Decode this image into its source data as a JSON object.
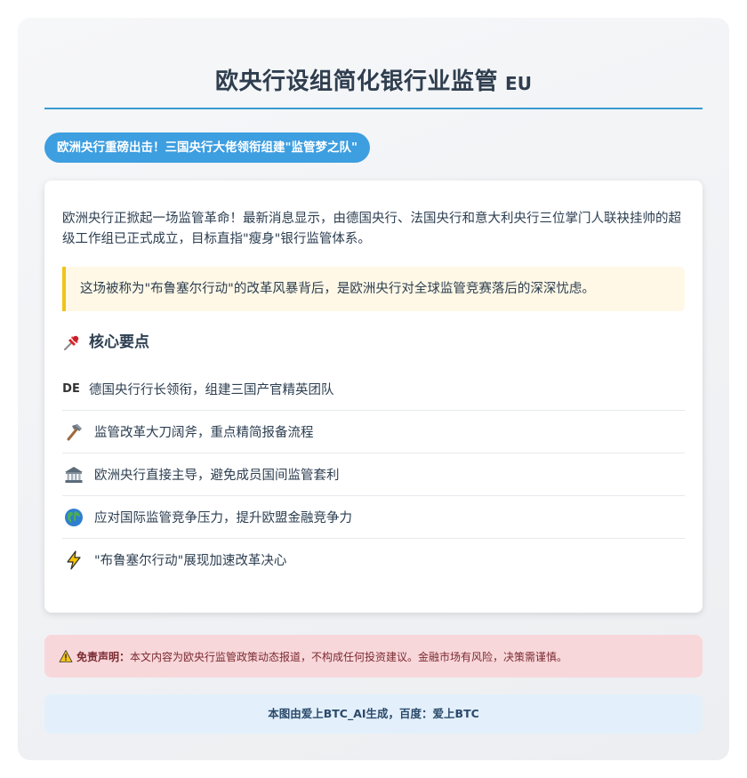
{
  "header": {
    "title": "欧央行设组简化银行业监管",
    "flag": "EU"
  },
  "badge": "欧洲央行重磅出击！三国央行大佬领衔组建\"监管梦之队\"",
  "article": {
    "intro": "欧洲央行正掀起一场监管革命！最新消息显示，由德国央行、法国央行和意大利央行三位掌门人联袂挂帅的超级工作组已正式成立，目标直指\"瘦身\"银行监管体系。",
    "quote": "这场被称为\"布鲁塞尔行动\"的改革风暴背后，是欧洲央行对全球监管竞赛落后的深深忧虑。",
    "section_title": "核心要点",
    "section_icon": "pushpin-icon",
    "points": [
      {
        "icon": "DE",
        "text": "德国央行行长领衔，组建三国产官精英团队"
      },
      {
        "icon": "hammer-icon",
        "text": "监管改革大刀阔斧，重点精简报备流程"
      },
      {
        "icon": "bank-icon",
        "text": "欧洲央行直接主导，避免成员国间监管套利"
      },
      {
        "icon": "globe-icon",
        "text": "应对国际监管竞争压力，提升欧盟金融竞争力"
      },
      {
        "icon": "lightning-icon",
        "text": "\"布鲁塞尔行动\"展现加速改革决心"
      }
    ]
  },
  "disclaimer": {
    "icon": "warning-icon",
    "label": "免责声明：",
    "text": "本文内容为欧央行监管政策动态报道，不构成任何投资建议。金融市场有风险，决策需谨慎。"
  },
  "footer": "本图由爱上BTC_AI生成，百度：爱上BTC",
  "colors": {
    "accent": "#3d9ee0",
    "rule": "#3a9ad0",
    "quote_bg": "#fff8e6",
    "quote_border": "#f0c419",
    "disclaimer_bg": "#f8d7da",
    "footer_bg": "#e3f0fb"
  }
}
